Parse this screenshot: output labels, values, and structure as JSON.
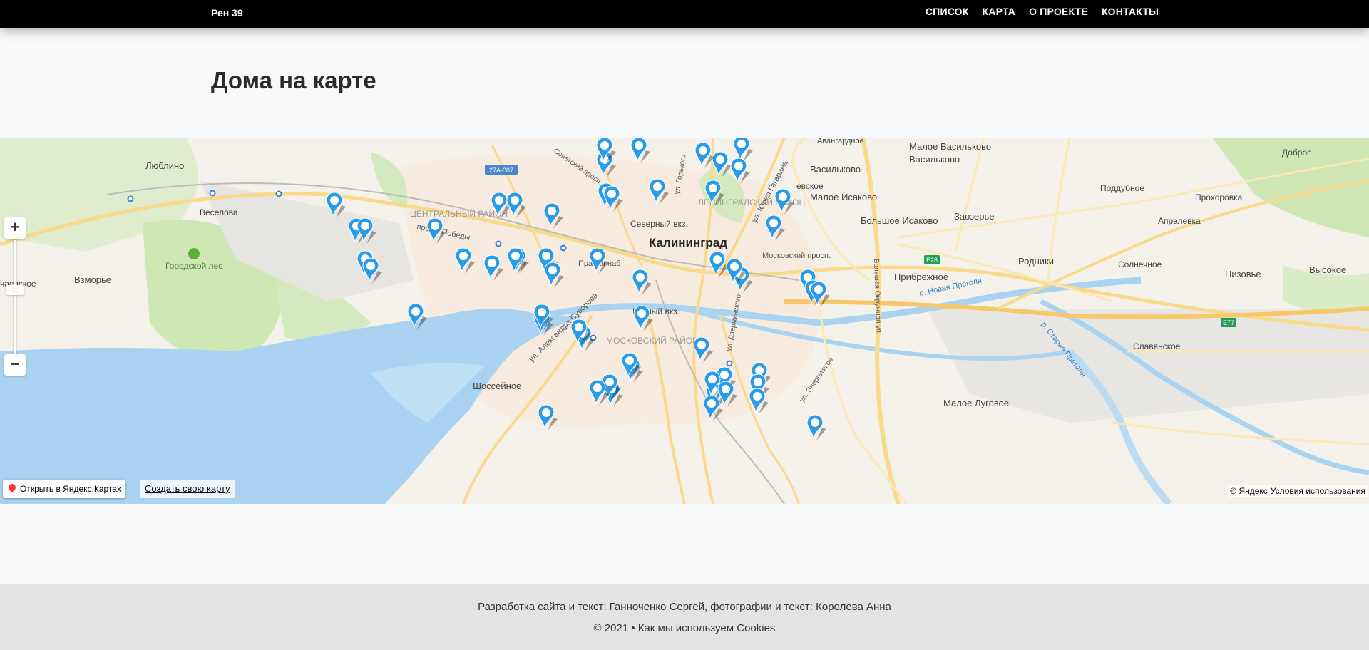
{
  "header": {
    "brand": "Рен 39",
    "nav": [
      "СПИСОК",
      "КАРТА",
      "О ПРОЕКТЕ",
      "КОНТАКТЫ"
    ]
  },
  "page": {
    "title": "Дома на карте"
  },
  "map": {
    "zoom_in_label": "+",
    "zoom_out_label": "−",
    "open_in_yandex": "Открыть в Яндекс.Картах",
    "create_map": "Создать свою карту",
    "copyright": "© Яндекс",
    "terms": "Условия использования",
    "marker_color": "#2a9be8",
    "places": [
      "Калининград",
      "Люблино",
      "Веселова",
      "Городской лес",
      "Взморье",
      "чаевское",
      "Шоссейное",
      "Малое Васильково",
      "Васильково",
      "Малое Исаково",
      "Большое Исаково",
      "Заозерье",
      "Прибрежное",
      "Родники",
      "Солнечное",
      "Низовье",
      "Высокое",
      "Славянское",
      "Малое Луговое",
      "Доброе",
      "Поддубное",
      "Прохоровка",
      "Апрелевка",
      "Авангардное",
      "Северный вкз.",
      "Южный вкз.",
      "ЦЕНТРАЛЬНЫЙ РАЙОН",
      "ЛЕНИНГРАДСКИЙ РАЙОН",
      "МОСКОВСКИЙ РАЙОН",
      "просп. Победы",
      "Правая наб",
      "Московский просп.",
      "ул. Юрия Гагарина",
      "Большая Окружная ул.",
      "р. Новая Преголя",
      "р. Старая Преголя",
      "ул. Александра Суворова",
      "ул. Энергетиков",
      "Советский просп.",
      "ул. Дзержинского",
      "ул. Горького",
      "евское"
    ],
    "road_badges": [
      "27А-007",
      "Е28",
      "Е77"
    ]
  },
  "footer": {
    "credits": "Разработка сайта и текст: Ганноченко Сергей, фотографии и текст: Королева Анна",
    "copyright": "© 2021 • Как мы используем Cookies"
  }
}
